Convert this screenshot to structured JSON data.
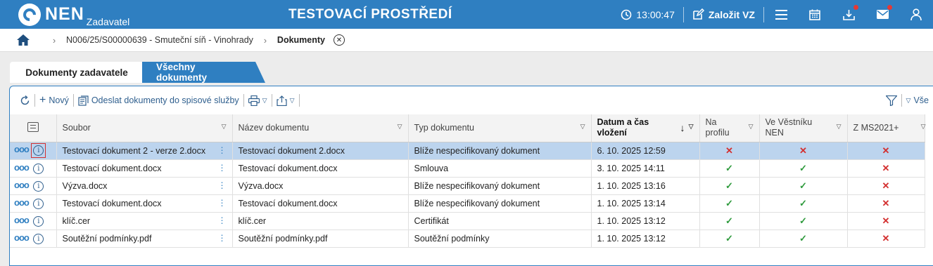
{
  "header": {
    "logo_text": "NEN",
    "logo_sub": "Zadavatel",
    "env_title": "TESTOVACÍ PROSTŘEDÍ",
    "time": "13:00:47",
    "create_label": "Založit VZ"
  },
  "breadcrumb": {
    "item1": "N006/25/S00000639 - Smuteční síň - Vinohrady",
    "current": "Dokumenty"
  },
  "tabs": {
    "active": "Dokumenty zadavatele",
    "inactive": "Všechny dokumenty"
  },
  "toolbar": {
    "new_label": "Nový",
    "send_label": "Odeslat dokumenty do spisové služby",
    "right_label": "Vše"
  },
  "table": {
    "headers": {
      "soubor": "Soubor",
      "nazev": "Název dokumentu",
      "typ": "Typ dokumentu",
      "datum": "Datum a čas vložení",
      "profil": "Na profilu",
      "vestnik": "Ve Věstníku NEN",
      "ms": "Z MS2021+"
    },
    "rows": [
      {
        "soubor": "Testovací dokument 2 - verze 2.docx",
        "nazev": "Testovací dokument 2.docx",
        "typ": "Blíže nespecifikovaný dokument",
        "datum": "6. 10. 2025 12:59",
        "profil": "✕",
        "vestnik": "✕",
        "ms": "✕"
      },
      {
        "soubor": "Testovací dokument.docx",
        "nazev": "Testovací dokument.docx",
        "typ": "Smlouva",
        "datum": "3. 10. 2025 14:11",
        "profil": "✓",
        "vestnik": "✓",
        "ms": "✕"
      },
      {
        "soubor": "Výzva.docx",
        "nazev": "Výzva.docx",
        "typ": "Blíže nespecifikovaný dokument",
        "datum": "1. 10. 2025 13:16",
        "profil": "✓",
        "vestnik": "✓",
        "ms": "✕"
      },
      {
        "soubor": "Testovací dokument.docx",
        "nazev": "Testovací dokument.docx",
        "typ": "Blíže nespecifikovaný dokument",
        "datum": "1. 10. 2025 13:14",
        "profil": "✓",
        "vestnik": "✓",
        "ms": "✕"
      },
      {
        "soubor": "klíč.cer",
        "nazev": "klíč.cer",
        "typ": "Certifikát",
        "datum": "1. 10. 2025 13:12",
        "profil": "✓",
        "vestnik": "✓",
        "ms": "✕"
      },
      {
        "soubor": "Soutěžní podmínky.pdf",
        "nazev": "Soutěžní podmínky.pdf",
        "typ": "Soutěžní podmínky",
        "datum": "1. 10. 2025 13:12",
        "profil": "✓",
        "vestnik": "✓",
        "ms": "✕"
      }
    ]
  },
  "colors": {
    "brand": "#2f7fc1",
    "selected_row": "#bcd4ee",
    "ok": "#2e9a3c",
    "no": "#d32f2f"
  }
}
